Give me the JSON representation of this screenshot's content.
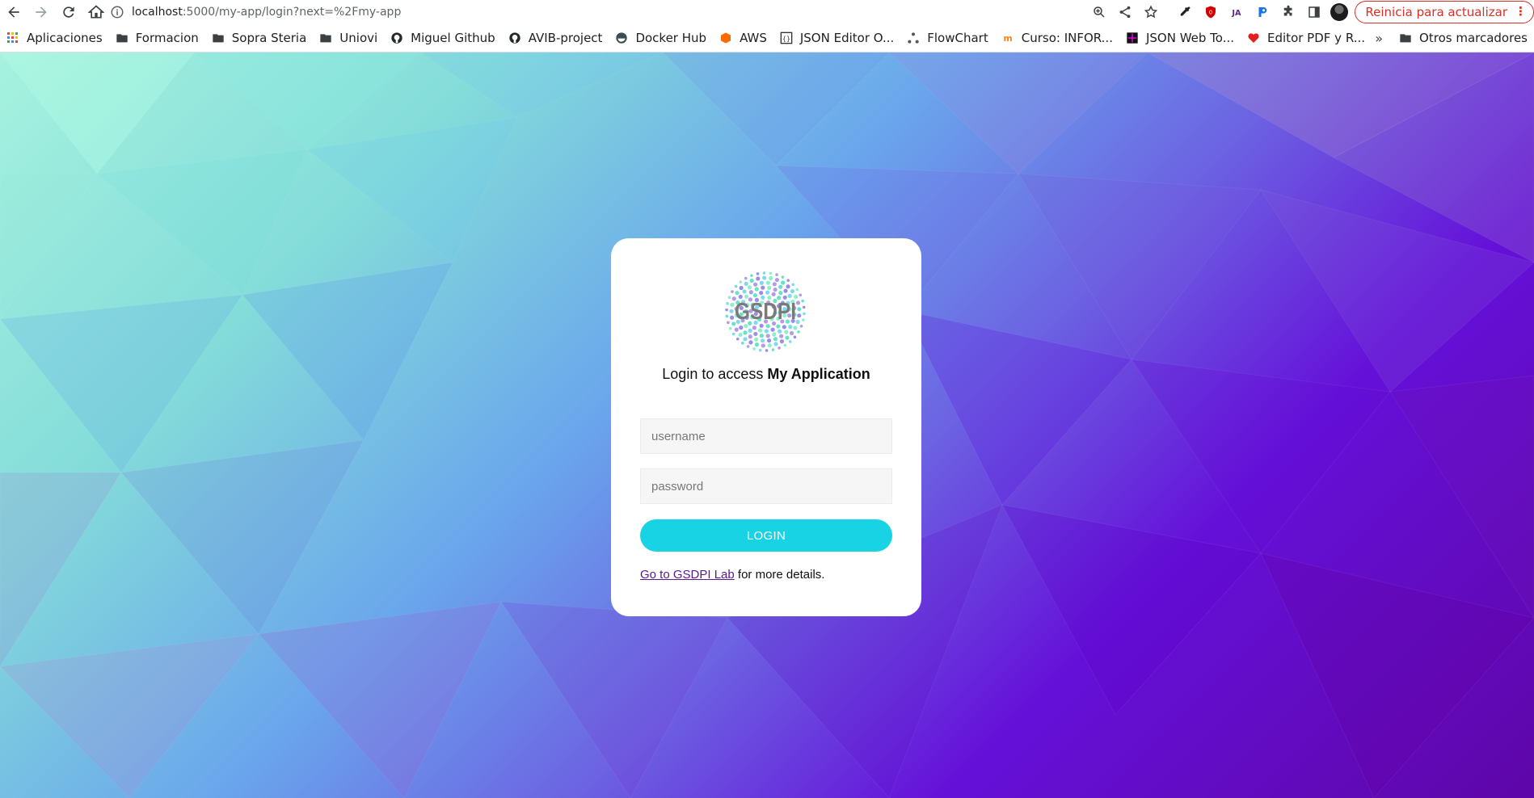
{
  "browser": {
    "url_host": "localhost",
    "url_path": ":5000/my-app/login?next=%2Fmy-app",
    "update_label": "Reinicia para actualizar",
    "more_menu": "⋮",
    "bookmarks": [
      {
        "label": "Aplicaciones",
        "icon": "apps-grid-icon"
      },
      {
        "label": "Formacion",
        "icon": "folder-icon"
      },
      {
        "label": "Sopra Steria",
        "icon": "folder-icon"
      },
      {
        "label": "Uniovi",
        "icon": "folder-icon"
      },
      {
        "label": "Miguel Github",
        "icon": "github-icon"
      },
      {
        "label": "AVIB-project",
        "icon": "github-icon"
      },
      {
        "label": "Docker Hub",
        "icon": "docker-icon"
      },
      {
        "label": "AWS",
        "icon": "aws-icon"
      },
      {
        "label": "JSON Editor O...",
        "icon": "json-editor-icon"
      },
      {
        "label": "FlowChart",
        "icon": "flowchart-icon"
      },
      {
        "label": "Curso: INFOR...",
        "icon": "moodle-icon"
      },
      {
        "label": "JSON Web To...",
        "icon": "jwt-icon"
      },
      {
        "label": "Editor PDF y R...",
        "icon": "pdf-heart-icon"
      }
    ],
    "overflow_chevron": "»",
    "other_bookmarks": "Otros marcadores"
  },
  "login": {
    "logo_text": "GSDPI",
    "headline_prefix": "Login to access ",
    "app_name": "My Application",
    "username_placeholder": "username",
    "password_placeholder": "password",
    "login_button": "LOGIN",
    "link_text": "Go to GSDPI Lab",
    "details_suffix": " for more details."
  },
  "colors": {
    "login_button": "#17d3e3",
    "update_button": "#d93025",
    "link": "#551a8b"
  }
}
